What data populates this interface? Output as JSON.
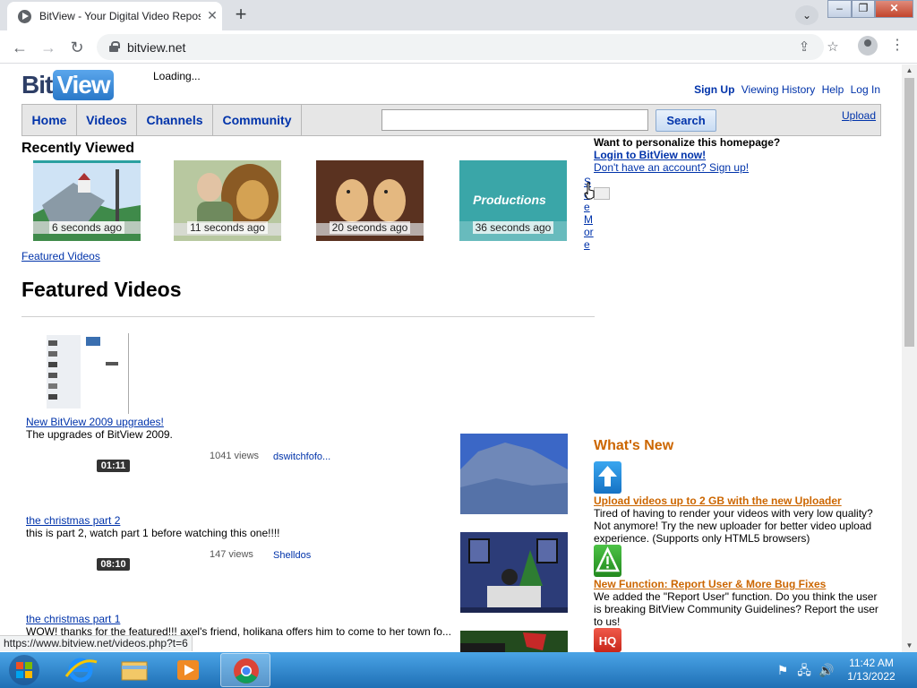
{
  "browser": {
    "tab_title": "BitView - Your Digital Video Repository",
    "url": "bitview.net",
    "status_url": "https://www.bitview.net/videos.php?t=6"
  },
  "site": {
    "logo_part1": "Bit",
    "logo_part2": "View",
    "loading": "Loading...",
    "toplinks": [
      "Sign Up",
      "Viewing History",
      "Help",
      "Log In"
    ],
    "nav": [
      "Home",
      "Videos",
      "Channels",
      "Community"
    ],
    "search_button": "Search",
    "search_value": "",
    "upload": "Upload"
  },
  "recently_viewed": {
    "title": "Recently Viewed",
    "items": [
      {
        "time": "6 seconds ago"
      },
      {
        "time": "11 seconds ago"
      },
      {
        "time": "20 seconds ago"
      },
      {
        "time": "36 seconds ago",
        "caption": "Productions"
      }
    ],
    "see_more": "See More",
    "featured_link": "Featured Videos"
  },
  "personalize": {
    "question": "Want to personalize this homepage?",
    "login": "Login to BitView now!",
    "signup": "Don't have an account? Sign up!"
  },
  "featured": {
    "title": "Featured Videos",
    "videos": [
      {
        "title": "New BitView 2009 upgrades!",
        "desc": "The upgrades of BitView 2009.",
        "duration": "01:11",
        "views": "1041 views",
        "user": "dswitchfofo..."
      },
      {
        "title": "the christmas part 2",
        "desc": "this is part 2, watch part 1 before watching this one!!!!",
        "duration": "08:10",
        "views": "147 views",
        "user": "Shelldos"
      },
      {
        "title": "the christmas part 1",
        "desc": "WOW! thanks for the featured!!! axel's friend, holikana offers him to come to her town fo..."
      }
    ]
  },
  "whats_new": {
    "title": "What's New",
    "items": [
      {
        "head": "Upload videos up to 2 GB with the new Uploader",
        "text": "Tired of having to render your videos with very low quality? Not anymore! Try the new uploader for better video upload experience. (Supports only HTML5 browsers)"
      },
      {
        "head": "New Function: Report User & More Bug Fixes",
        "text": "We added the \"Report User\" function. Do you think the user is breaking BitView Community Guidelines? Report the user to us!"
      }
    ],
    "hq_label": "HQ"
  },
  "taskbar": {
    "time": "11:42 AM",
    "date": "1/13/2022"
  }
}
